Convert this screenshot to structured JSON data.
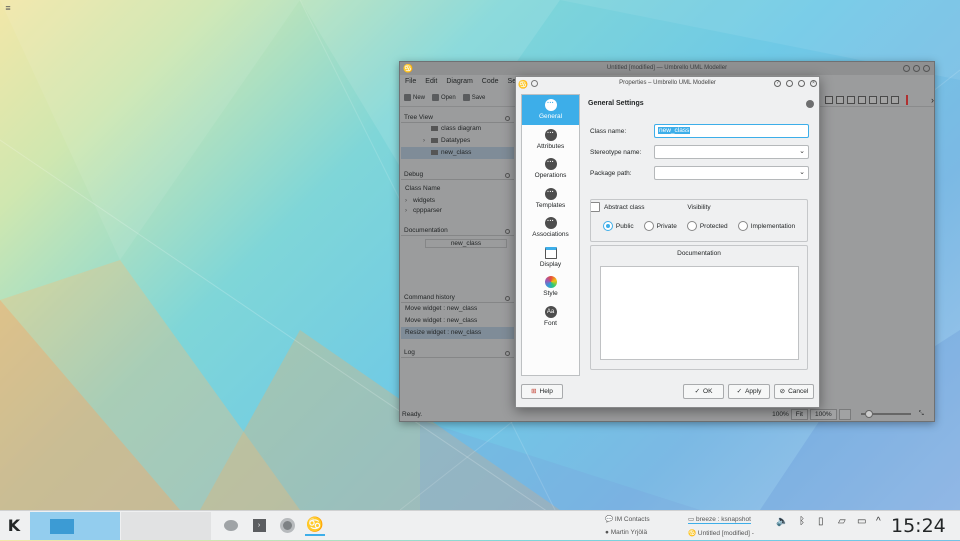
{
  "main_window": {
    "title": "Untitled [modified] — Umbrello UML Modeller",
    "menu": [
      "File",
      "Edit",
      "Diagram",
      "Code",
      "Se"
    ],
    "toolbar": [
      "New",
      "Open",
      "Save"
    ],
    "tree_view": {
      "title": "Tree View",
      "items": [
        "class diagram",
        "Datatypes",
        "new_class"
      ]
    },
    "debug": {
      "title": "Debug",
      "header": "Class Name",
      "items": [
        "widgets",
        "cppparser"
      ]
    },
    "documentation": {
      "title": "Documentation",
      "value": "new_class"
    },
    "command_history": {
      "title": "Command history",
      "items": [
        "Move widget : new_class",
        "Move widget : new_class",
        "Resize widget : new_class"
      ]
    },
    "log": {
      "title": "Log"
    },
    "status": {
      "text": "Ready.",
      "zoom1": "100%",
      "fit": "Fit",
      "zoom2": "100%"
    }
  },
  "dialog": {
    "title": "Properties – Umbrello UML Modeller",
    "sidebar": [
      "General",
      "Attributes",
      "Operations",
      "Templates",
      "Associations",
      "Display",
      "Style",
      "Font"
    ],
    "section_title": "General Settings",
    "fields": {
      "class_name_label": "Class name:",
      "class_name_value": "new_class",
      "stereotype_label": "Stereotype name:",
      "package_label": "Package path:"
    },
    "abstract_label": "Abstract class",
    "visibility": {
      "title": "Visibility",
      "options": [
        "Public",
        "Private",
        "Protected",
        "Implementation"
      ],
      "selected": "Public"
    },
    "documentation_title": "Documentation",
    "buttons": {
      "help": "Help",
      "ok": "OK",
      "apply": "Apply",
      "cancel": "Cancel"
    }
  },
  "taskbar": {
    "tasks": [
      "IM Contacts",
      "Martin Yrjölä",
      "breeze : ksnapshot",
      "Untitled [modified] -"
    ],
    "clock": "15:24"
  }
}
